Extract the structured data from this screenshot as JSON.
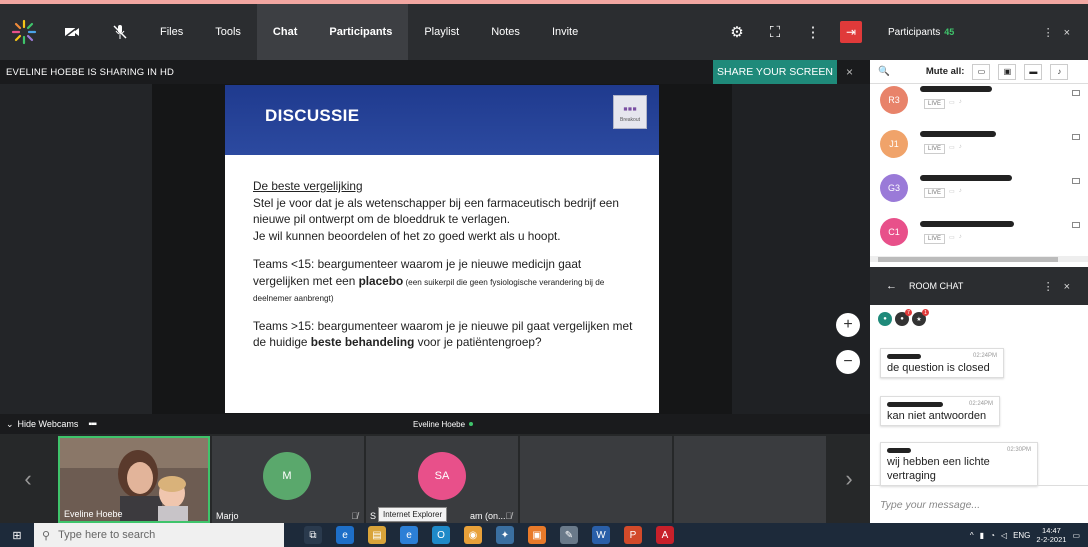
{
  "toolbar": {
    "items": [
      "Files",
      "Tools",
      "Chat",
      "Participants",
      "Playlist",
      "Notes",
      "Invite"
    ],
    "active": [
      "Chat",
      "Participants"
    ]
  },
  "sharing": {
    "label": "EVELINE HOEBE IS SHARING IN HD",
    "share_button": "SHARE YOUR SCREEN",
    "close": "×"
  },
  "slide": {
    "title": "DISCUSSIE",
    "breakout_label": "Breakout",
    "heading": "De beste vergelijking",
    "para1": "Stel je voor dat je als wetenschapper bij een farmaceutisch bedrijf een nieuwe pil ontwerpt om de bloeddruk te verlagen.",
    "para1b": "Je wil kunnen beoordelen of het zo goed werkt als u hoopt.",
    "teams1_a": "Teams <15: beargumenteer waarom je je nieuwe medicijn gaat vergelijken met een ",
    "teams1_bold": "placebo",
    "teams1_small": " (een suikerpil die geen fysiologische verandering bij de deelnemer aanbrengt)",
    "teams2_a": "Teams >15: beargumenteer waarom je je nieuwe pil gaat vergelijken met de huidige ",
    "teams2_bold": "beste behandeling",
    "teams2_c": " voor je patiëntengroep?"
  },
  "zoom": {
    "in": "+",
    "out": "−"
  },
  "webcams": {
    "hide_label": "Hide Webcams",
    "presenter": "Eveline Hoebe",
    "tiles": [
      {
        "name": "Eveline Hoebe",
        "initials": ""
      },
      {
        "name": "Marjo",
        "initials": "M",
        "color": "#5aa86c"
      },
      {
        "name": "S",
        "name_suffix": "am (on...",
        "initials": "SA",
        "color": "#e8508a"
      }
    ],
    "tooltip": "Internet Explorer"
  },
  "participants_panel": {
    "title": "Participants",
    "count": "45",
    "mute_all": "Mute all:",
    "rows": [
      {
        "initials": "R3",
        "color": "#e8836a"
      },
      {
        "initials": "J1",
        "color": "#f0a36a"
      },
      {
        "initials": "G3",
        "color": "#9a7ad8"
      },
      {
        "initials": "C1",
        "color": "#e8508a"
      }
    ],
    "live_label": "LIVE"
  },
  "room_chat": {
    "title": "ROOM CHAT",
    "tab_badges": [
      "7",
      "1"
    ],
    "messages": [
      {
        "time": "02:24PM",
        "text": "de question is closed"
      },
      {
        "time": "02:24PM",
        "text": "kan niet antwoorden"
      },
      {
        "time": "02:30PM",
        "text": "wij hebben een lichte vertraging"
      }
    ],
    "input_placeholder": "Type your message..."
  },
  "taskbar": {
    "search_placeholder": "Type here to search",
    "lang": "ENG",
    "time": "14:47",
    "date": "2-2-2021"
  }
}
